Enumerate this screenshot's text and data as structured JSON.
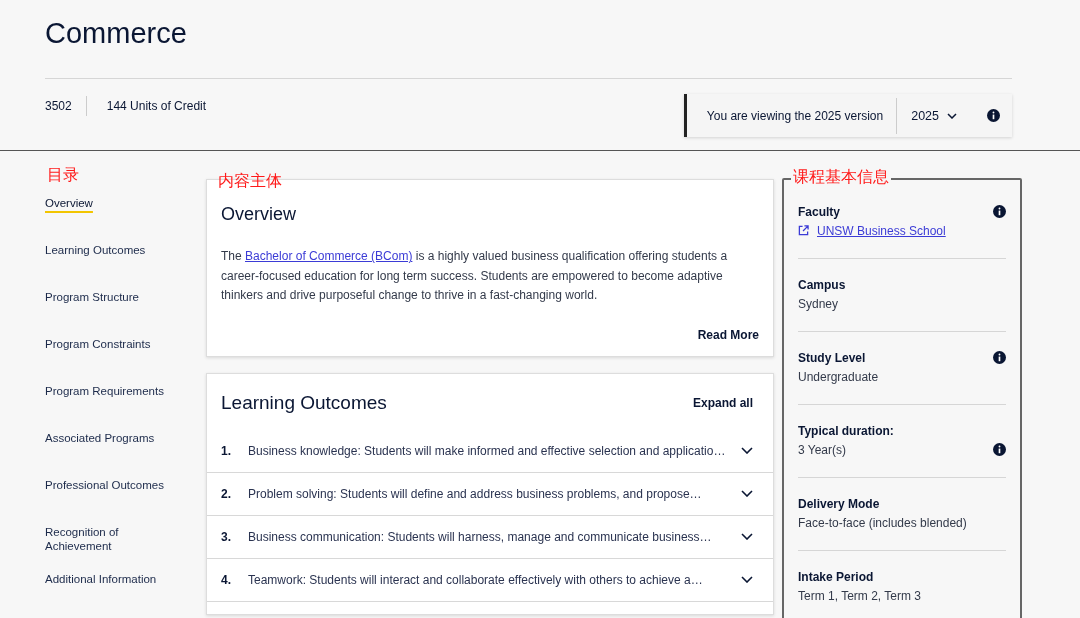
{
  "page_title": "Commerce",
  "meta": {
    "code": "3502",
    "units": "144 Units of Credit"
  },
  "version": {
    "message": "You are viewing the 2025 version",
    "year": "2025"
  },
  "annotations": {
    "toc": "目录",
    "content": "内容主体",
    "info": "课程基本信息"
  },
  "toc": [
    {
      "label": "Overview",
      "selected": true
    },
    {
      "label": "Learning Outcomes",
      "selected": false
    },
    {
      "label": "Program Structure",
      "selected": false
    },
    {
      "label": "Program Constraints",
      "selected": false
    },
    {
      "label": "Program Requirements",
      "selected": false
    },
    {
      "label": "Associated Programs",
      "selected": false
    },
    {
      "label": "Professional Outcomes",
      "selected": false
    },
    {
      "label": "Recognition of Achievement",
      "selected": false
    },
    {
      "label": "Additional Information",
      "selected": false
    }
  ],
  "overview": {
    "title": "Overview",
    "text_before": "The ",
    "link": "Bachelor of Commerce (BCom)",
    "text_after": " is a highly valued business qualification offering students a career-focused education for long term success. Students are empowered to become adaptive thinkers and drive purposeful change to thrive in a fast-changing world.",
    "read_more": "Read More"
  },
  "learning_outcomes": {
    "title": "Learning Outcomes",
    "expand_all": "Expand all",
    "items": [
      {
        "number": "1.",
        "text": "Business knowledge: Students will make informed and effective selection and applicatio…",
        "expanded": false
      },
      {
        "number": "2.",
        "text": "Problem solving: Students will define and address business problems, and propose…",
        "expanded": false
      },
      {
        "number": "3.",
        "text": "Business communication: Students will harness, manage and communicate business…",
        "expanded": false
      },
      {
        "number": "4.",
        "text": "Teamwork: Students will interact and collaborate effectively with others to achieve a…",
        "expanded": false
      }
    ]
  },
  "info_panel": [
    {
      "label": "Faculty",
      "value": "UNSW Business School",
      "kind": "link",
      "label_info": true,
      "value_info": false
    },
    {
      "label": "Campus",
      "value": "Sydney",
      "kind": "text",
      "label_info": false,
      "value_info": false
    },
    {
      "label": "Study Level",
      "value": "Undergraduate",
      "kind": "text",
      "label_info": true,
      "value_info": false
    },
    {
      "label": "Typical duration:",
      "value": "3 Year(s)",
      "kind": "text",
      "label_info": false,
      "value_info": true
    },
    {
      "label": "Delivery Mode",
      "value": "Face-to-face (includes blended)",
      "kind": "text",
      "label_info": false,
      "value_info": false
    },
    {
      "label": "Intake Period",
      "value": "Term 1, Term 2, Term 3",
      "kind": "text",
      "label_info": false,
      "value_info": false
    }
  ]
}
